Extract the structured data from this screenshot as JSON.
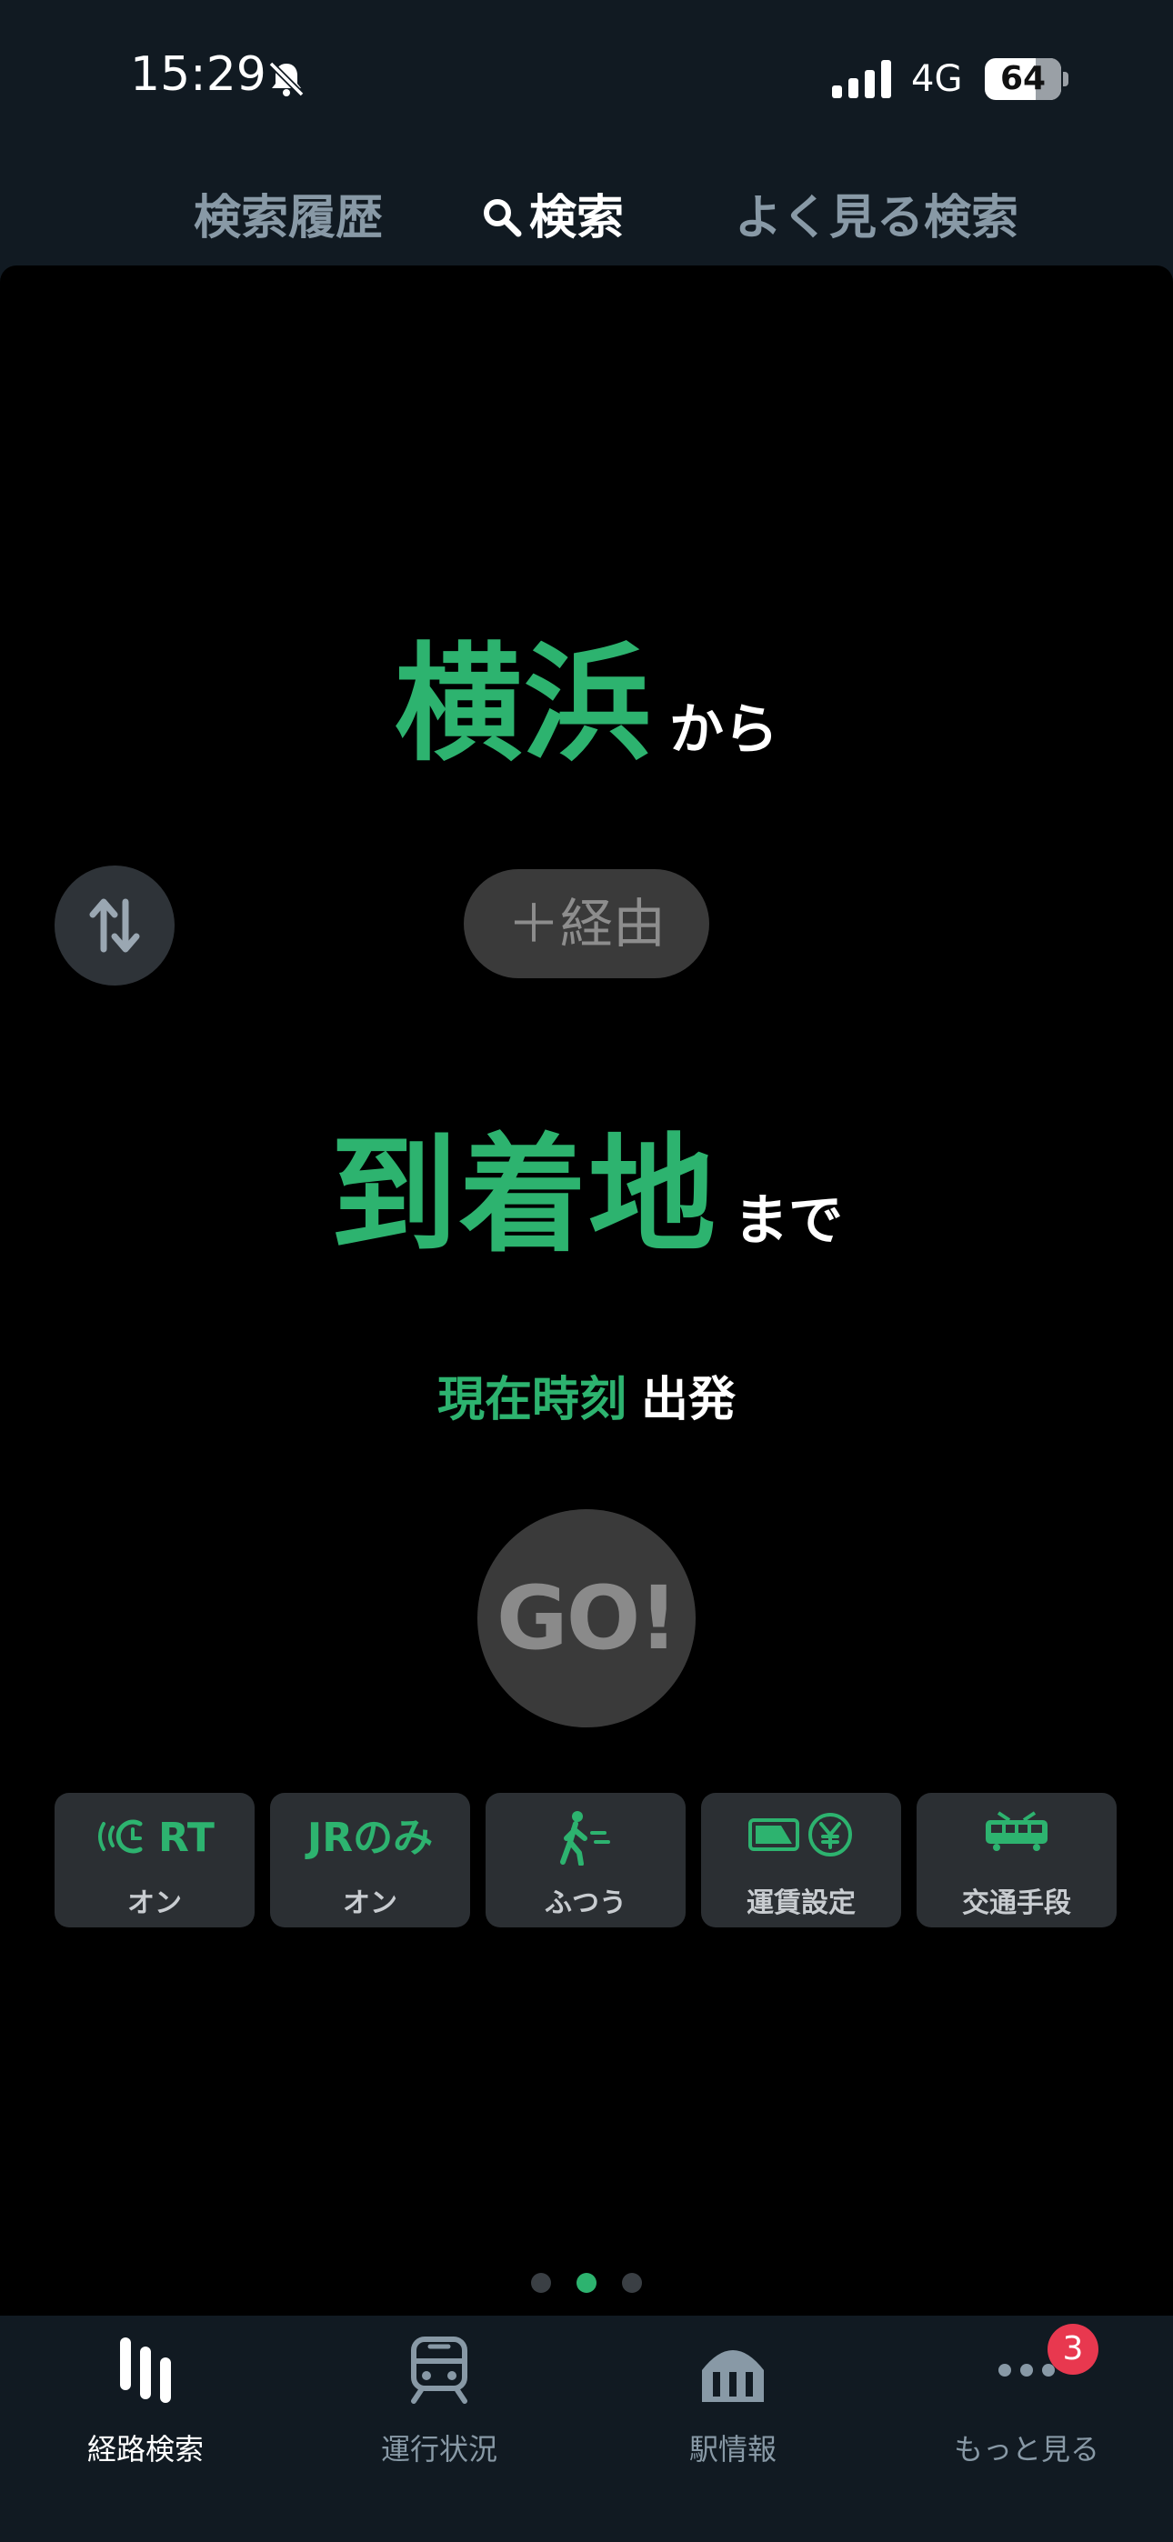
{
  "status_bar": {
    "time": "15:29",
    "network": "4G",
    "battery": "64"
  },
  "top_tabs": [
    {
      "label": "検索履歴"
    },
    {
      "label": "検索"
    },
    {
      "label": "よく見る検索"
    }
  ],
  "search": {
    "origin": "横浜",
    "origin_suffix": "から",
    "via_label": "＋経由",
    "destination": "到着地",
    "destination_suffix": "まで",
    "time_label": "現在時刻",
    "time_mode": "出発",
    "go_label": "GO!"
  },
  "options": [
    {
      "icon": "realtime-icon",
      "icon_text": "RT",
      "label": "オン"
    },
    {
      "icon": "jr-only-icon",
      "icon_text": "JRのみ",
      "label": "オン"
    },
    {
      "icon": "walking-speed-icon",
      "icon_text": "",
      "label": "ふつう"
    },
    {
      "icon": "fare-settings-icon",
      "icon_text": "",
      "label": "運賃設定"
    },
    {
      "icon": "transport-mode-icon",
      "icon_text": "",
      "label": "交通手段"
    }
  ],
  "pagination": {
    "count": 3,
    "active": 1
  },
  "bottom_nav": [
    {
      "label": "経路検索",
      "icon": "route-search-icon",
      "active": true
    },
    {
      "label": "運行状況",
      "icon": "train-status-icon",
      "active": false
    },
    {
      "label": "駅情報",
      "icon": "station-info-icon",
      "active": false
    },
    {
      "label": "もっと見る",
      "icon": "more-icon",
      "active": false
    }
  ],
  "notification_badge": "3",
  "colors": {
    "accent": "#2db36f",
    "background": "#000000",
    "chrome": "#111a22",
    "badge": "#e8384f"
  }
}
